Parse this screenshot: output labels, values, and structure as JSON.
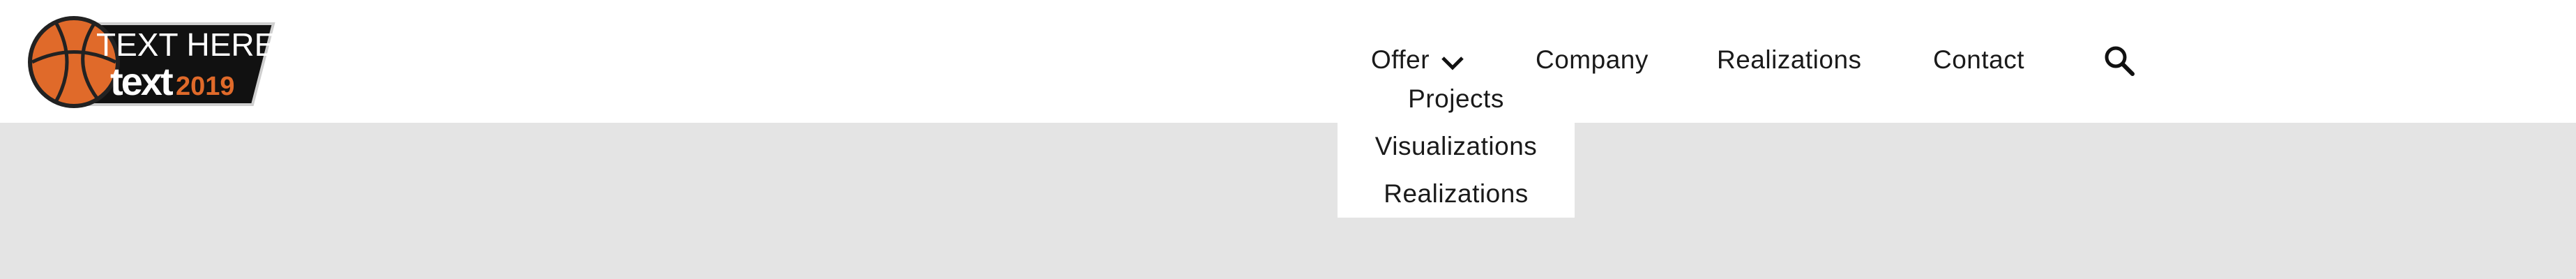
{
  "logo": {
    "line1": "TEXT HERE",
    "line2_main": "text",
    "line2_year": "2019",
    "icon": "basketball-icon",
    "colors": {
      "ball": "#e06a2a",
      "badge": "#111111",
      "year": "#e06a2a"
    }
  },
  "nav": {
    "items": [
      {
        "label": "Offer"
      },
      {
        "label": "Company"
      },
      {
        "label": "Realizations"
      },
      {
        "label": "Contact"
      }
    ],
    "search_icon": "search-icon",
    "dropdown_icon": "chevron-down-icon"
  },
  "dropdown": {
    "items": [
      {
        "label": "Projects"
      },
      {
        "label": "Visualizations"
      },
      {
        "label": "Realizations"
      }
    ]
  },
  "colors": {
    "header_bg": "#ffffff",
    "page_bg": "#e4e4e4",
    "text": "#1a1a1a"
  }
}
